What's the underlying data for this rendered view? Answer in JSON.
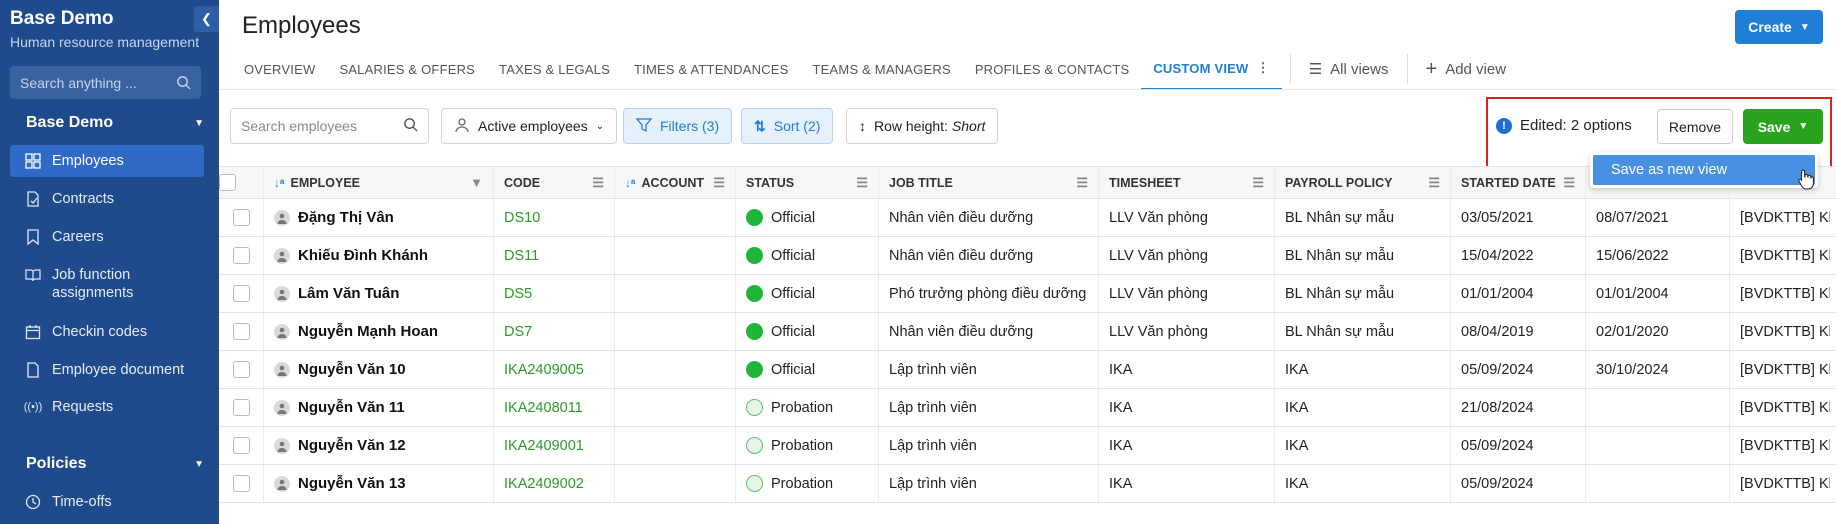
{
  "sidebar": {
    "brand": "Base Demo",
    "subtitle": "Human resource management",
    "collapse_icon": "chevron-left-icon",
    "search_placeholder": "Search anything ...",
    "section1": "Base Demo",
    "items": [
      {
        "label": "Employees",
        "icon": "grid-icon"
      },
      {
        "label": "Contracts",
        "icon": "contract-icon"
      },
      {
        "label": "Careers",
        "icon": "bookmark-icon"
      },
      {
        "label": "Job function assignments",
        "icon": "book-icon"
      },
      {
        "label": "Checkin codes",
        "icon": "calendar-icon"
      },
      {
        "label": "Employee document",
        "icon": "document-icon"
      },
      {
        "label": "Requests",
        "icon": "broadcast-icon"
      }
    ],
    "section2": "Policies",
    "items2": [
      {
        "label": "Time-offs",
        "icon": "clock-icon"
      }
    ]
  },
  "header": {
    "title": "Employees",
    "create_label": "Create"
  },
  "tabs": [
    {
      "label": "OVERVIEW"
    },
    {
      "label": "SALARIES & OFFERS"
    },
    {
      "label": "TAXES & LEGALS"
    },
    {
      "label": "TIMES & ATTENDANCES"
    },
    {
      "label": "TEAMS & MANAGERS"
    },
    {
      "label": "PROFILES & CONTACTS"
    },
    {
      "label": "CUSTOM VIEW",
      "active": true
    }
  ],
  "view_links": {
    "all_views": "All views",
    "add_view": "Add view"
  },
  "toolbar": {
    "search_placeholder": "Search employees",
    "active_employees": "Active employees",
    "filters": "Filters (3)",
    "sort": "Sort (2)",
    "row_height_prefix": "Row height:",
    "row_height_value": "Short",
    "edited": "Edited: 2 options",
    "remove": "Remove",
    "save": "Save",
    "save_as_new_view": "Save as new view"
  },
  "colors": {
    "sidebar_bg": "#1f4b8c",
    "accent": "#1f7fd6",
    "save_green": "#2aa41f",
    "official_green": "#1fb53a",
    "highlight_red": "#e0201c"
  },
  "table": {
    "columns": [
      "EMPLOYEE",
      "CODE",
      "ACCOUNT",
      "STATUS",
      "JOB TITLE",
      "TIMESHEET",
      "PAYROLL POLICY",
      "STARTED DATE"
    ],
    "rows": [
      {
        "name": "Đặng Thị Vân",
        "code": "DS10",
        "status": "Official",
        "job": "Nhân viên điều dưỡng",
        "timesheet": "LLV Văn phòng",
        "payroll": "BL Nhân sự mẫu",
        "started": "03/05/2021",
        "extra": "08/07/2021",
        "last": "[BVDKTTB] Kh"
      },
      {
        "name": "Khiếu Đình Khánh",
        "code": "DS11",
        "status": "Official",
        "job": "Nhân viên điều dưỡng",
        "timesheet": "LLV Văn phòng",
        "payroll": "BL Nhân sự mẫu",
        "started": "15/04/2022",
        "extra": "15/06/2022",
        "last": "[BVDKTTB] Kh"
      },
      {
        "name": "Lâm Văn Tuân",
        "code": "DS5",
        "status": "Official",
        "job": "Phó trưởng phòng điều dưỡng",
        "timesheet": "LLV Văn phòng",
        "payroll": "BL Nhân sự mẫu",
        "started": "01/01/2004",
        "extra": "01/01/2004",
        "last": "[BVDKTTB] Kh"
      },
      {
        "name": "Nguyễn Mạnh Hoan",
        "code": "DS7",
        "status": "Official",
        "job": "Nhân viên điều dưỡng",
        "timesheet": "LLV Văn phòng",
        "payroll": "BL Nhân sự mẫu",
        "started": "08/04/2019",
        "extra": "02/01/2020",
        "last": "[BVDKTTB] Kh"
      },
      {
        "name": "Nguyễn Văn 10",
        "code": "IKA2409005",
        "status": "Official",
        "job": "Lập trình viên",
        "timesheet": "IKA",
        "payroll": "IKA",
        "started": "05/09/2024",
        "extra": "30/10/2024",
        "last": "[BVDKTTB] Kh"
      },
      {
        "name": "Nguyễn Văn 11",
        "code": "IKA2408011",
        "status": "Probation",
        "job": "Lập trình viên",
        "timesheet": "IKA",
        "payroll": "IKA",
        "started": "21/08/2024",
        "extra": "",
        "last": "[BVDKTTB] Kh"
      },
      {
        "name": "Nguyễn Văn 12",
        "code": "IKA2409001",
        "status": "Probation",
        "job": "Lập trình viên",
        "timesheet": "IKA",
        "payroll": "IKA",
        "started": "05/09/2024",
        "extra": "",
        "last": "[BVDKTTB] Kh"
      },
      {
        "name": "Nguyễn Văn 13",
        "code": "IKA2409002",
        "status": "Probation",
        "job": "Lập trình viên",
        "timesheet": "IKA",
        "payroll": "IKA",
        "started": "05/09/2024",
        "extra": "",
        "last": "[BVDKTTB] Kh"
      }
    ]
  }
}
